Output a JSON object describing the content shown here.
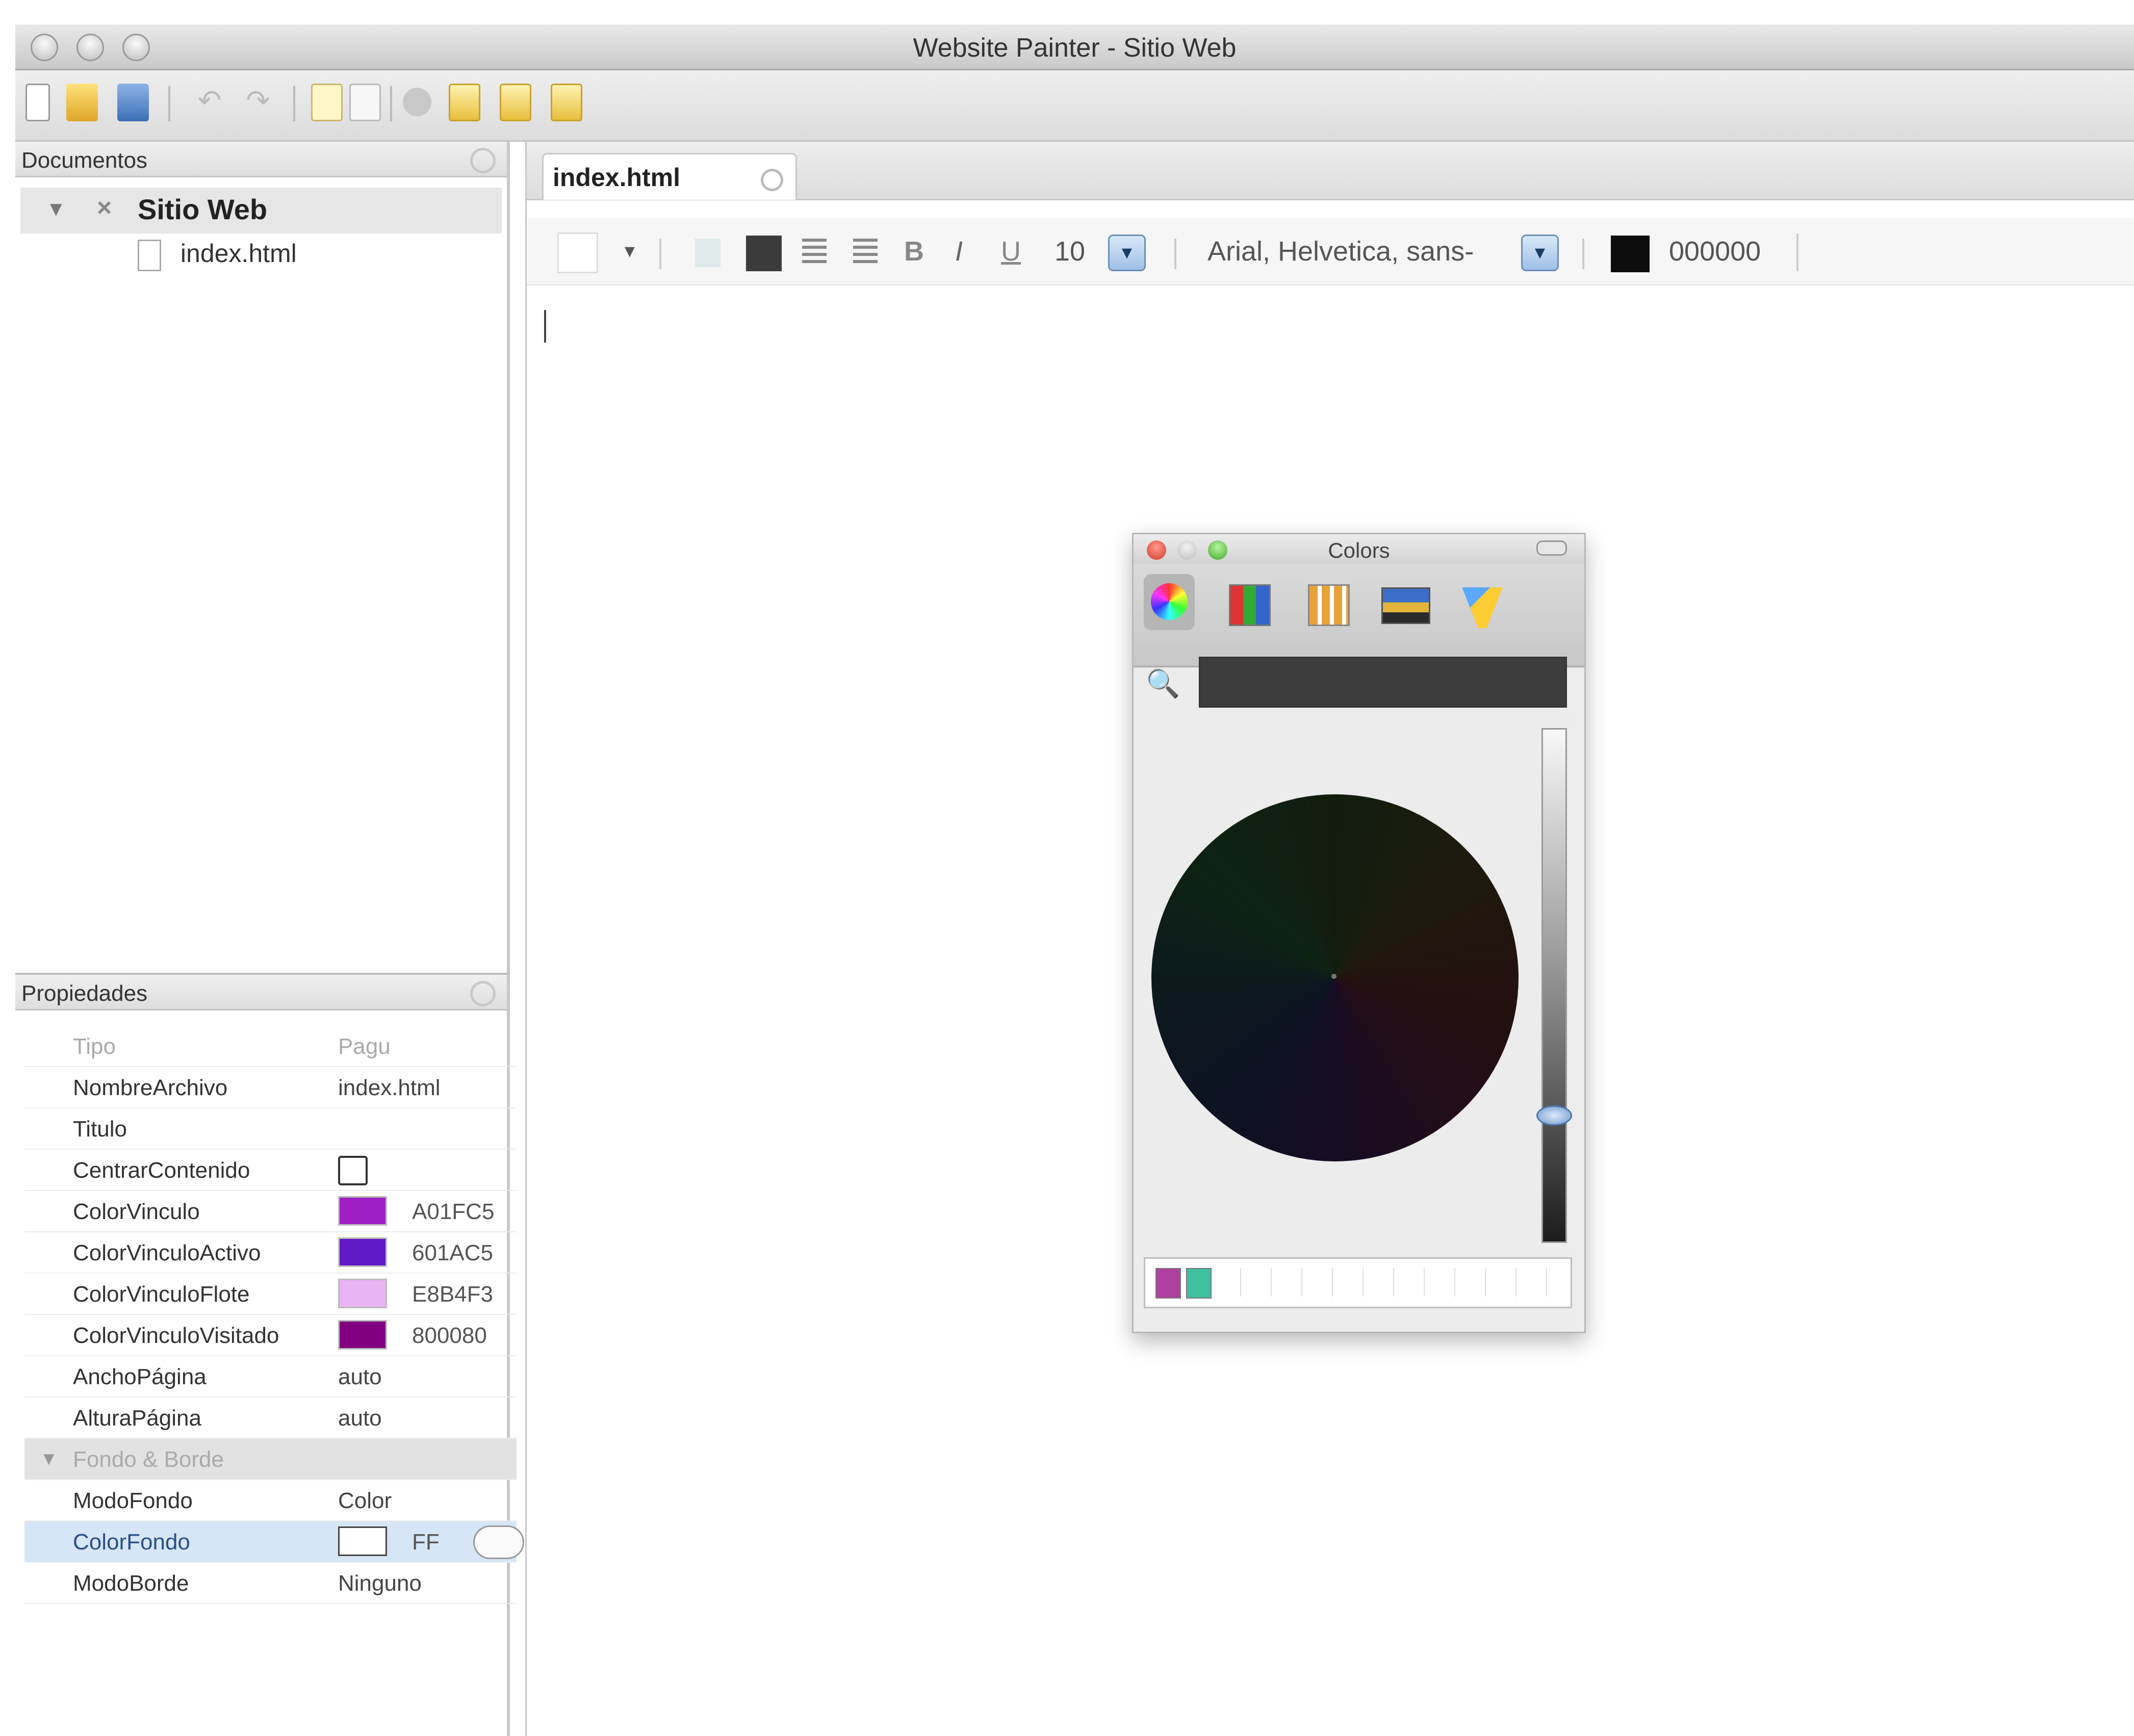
{
  "window": {
    "title": "Website Painter - Sitio Web"
  },
  "documents_panel": {
    "title": "Documentos",
    "tree": {
      "root_label": "Sitio Web",
      "files": [
        "index.html"
      ]
    }
  },
  "editor": {
    "active_tab": "index.html",
    "format_toolbar": {
      "font_size": "10",
      "font_family": "Arial, Helvetica, sans-",
      "text_color_hex": "000000"
    }
  },
  "properties_panel": {
    "title": "Propiedades",
    "rows": [
      {
        "key": "Tipo",
        "value": "Pagu"
      },
      {
        "key": "NombreArchivo",
        "value": "index.html"
      },
      {
        "key": "Titulo",
        "value": ""
      },
      {
        "key": "CentrarContenido",
        "value": ""
      },
      {
        "key": "ColorVinculo",
        "value": "A01FC5",
        "swatch": "#a01fc5"
      },
      {
        "key": "ColorVinculoActivo",
        "value": "601AC5",
        "swatch": "#601ac5"
      },
      {
        "key": "ColorVinculoFlote",
        "value": "E8B4F3",
        "swatch": "#e8b4f3"
      },
      {
        "key": "ColorVinculoVisitado",
        "value": "800080",
        "swatch": "#800080"
      },
      {
        "key": "AnchoPágina",
        "value": "auto"
      },
      {
        "key": "AlturaPágina",
        "value": "auto"
      }
    ],
    "section_label": "Fondo & Borde",
    "section_rows": [
      {
        "key": "ModoFondo",
        "value": "Color"
      },
      {
        "key": "ColorFondo",
        "value": "FF",
        "swatch": "#ffffff"
      },
      {
        "key": "ModoBorde",
        "value": "Ninguno"
      }
    ]
  },
  "colors_panel": {
    "title": "Colors",
    "tray_swatches": [
      "#b040a0",
      "#40c0a0"
    ]
  },
  "colors": {
    "window_bg": "#ffffff",
    "selection": "#d6e6f6"
  }
}
